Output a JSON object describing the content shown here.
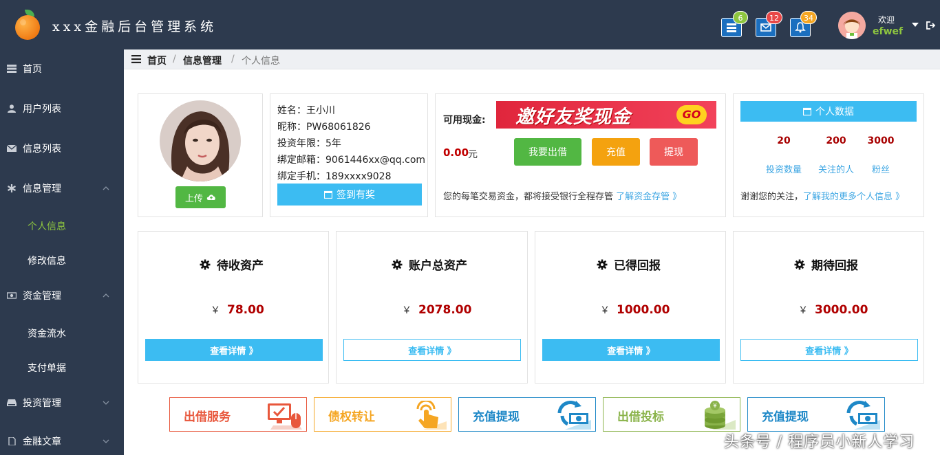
{
  "header": {
    "brand": "xxx金融后台管理系统",
    "badges": {
      "list": "6",
      "mail": "12",
      "bell": "34"
    },
    "welcome": "欢迎",
    "username": "efwef",
    "colors": {
      "bg": "#2d3a4e",
      "green_badge": "#8ec63f",
      "red_badge": "#e84747",
      "orange_badge": "#f5a623"
    }
  },
  "sidebar": {
    "items": [
      {
        "label": "首页",
        "icon": "list-icon"
      },
      {
        "label": "用户列表",
        "icon": "user-icon"
      },
      {
        "label": "信息列表",
        "icon": "envelope-icon"
      },
      {
        "label": "信息管理",
        "icon": "asterisk-icon",
        "expanded": true
      },
      {
        "label": "资金管理",
        "icon": "money-icon",
        "expanded": true
      },
      {
        "label": "投资管理",
        "icon": "hdd-icon",
        "expanded": false
      },
      {
        "label": "金融文章",
        "icon": "file-icon",
        "expanded": false
      }
    ],
    "info_sub": [
      "个人信息",
      "修改信息"
    ],
    "fund_sub": [
      "资金流水",
      "支付单据"
    ]
  },
  "breadcrumb": {
    "home": "首页",
    "sep": "/",
    "section": "信息管理",
    "current": "个人信息"
  },
  "profile": {
    "upload": "上传",
    "name": "姓名：王小川",
    "nickname": "昵称：PW68061826",
    "years": "投资年限：5年",
    "email": "绑定邮箱：9061446xx@qq.com",
    "phone": "绑定手机：189xxxx9028",
    "signin": "签到有奖"
  },
  "balance": {
    "label": "可用现金:",
    "banner_text": "邀好友奖现金",
    "banner_go": "GO",
    "amount": "0.00",
    "unit": "元",
    "btn_lend": "我要出借",
    "btn_recharge": "充值",
    "btn_withdraw": "提现",
    "note": "您的每笔交易资金，都将接受银行全程存管",
    "note_link": "了解资金存管 》"
  },
  "personal": {
    "header": "个人数据",
    "stats": [
      {
        "value": "20",
        "label": "投资数量"
      },
      {
        "value": "200",
        "label": "关注的人"
      },
      {
        "value": "3000",
        "label": "粉丝"
      }
    ],
    "thanks": "谢谢您的关注，",
    "thanks_link": "了解我的更多个人信息 》"
  },
  "assets": [
    {
      "title": "待收资产",
      "yen": "￥",
      "value": "78.00",
      "detail": "查看详情 》"
    },
    {
      "title": "账户总资产",
      "yen": "￥",
      "value": "2078.00",
      "detail": "查看详情 》"
    },
    {
      "title": "已得回报",
      "yen": "￥",
      "value": "1000.00",
      "detail": "查看详情 》"
    },
    {
      "title": "期待回报",
      "yen": "￥",
      "value": "3000.00",
      "detail": "查看详情 》"
    }
  ],
  "services": [
    {
      "label": "出借服务",
      "color": "#e8573c"
    },
    {
      "label": "债权转让",
      "color": "#f5a623"
    },
    {
      "label": "充值提现",
      "color": "#1e88c7"
    },
    {
      "label": "出借投标",
      "color": "#8ab34a"
    },
    {
      "label": "充值提现",
      "color": "#1e88c7"
    }
  ],
  "watermark": "头条号 / 程序员小新人学习"
}
